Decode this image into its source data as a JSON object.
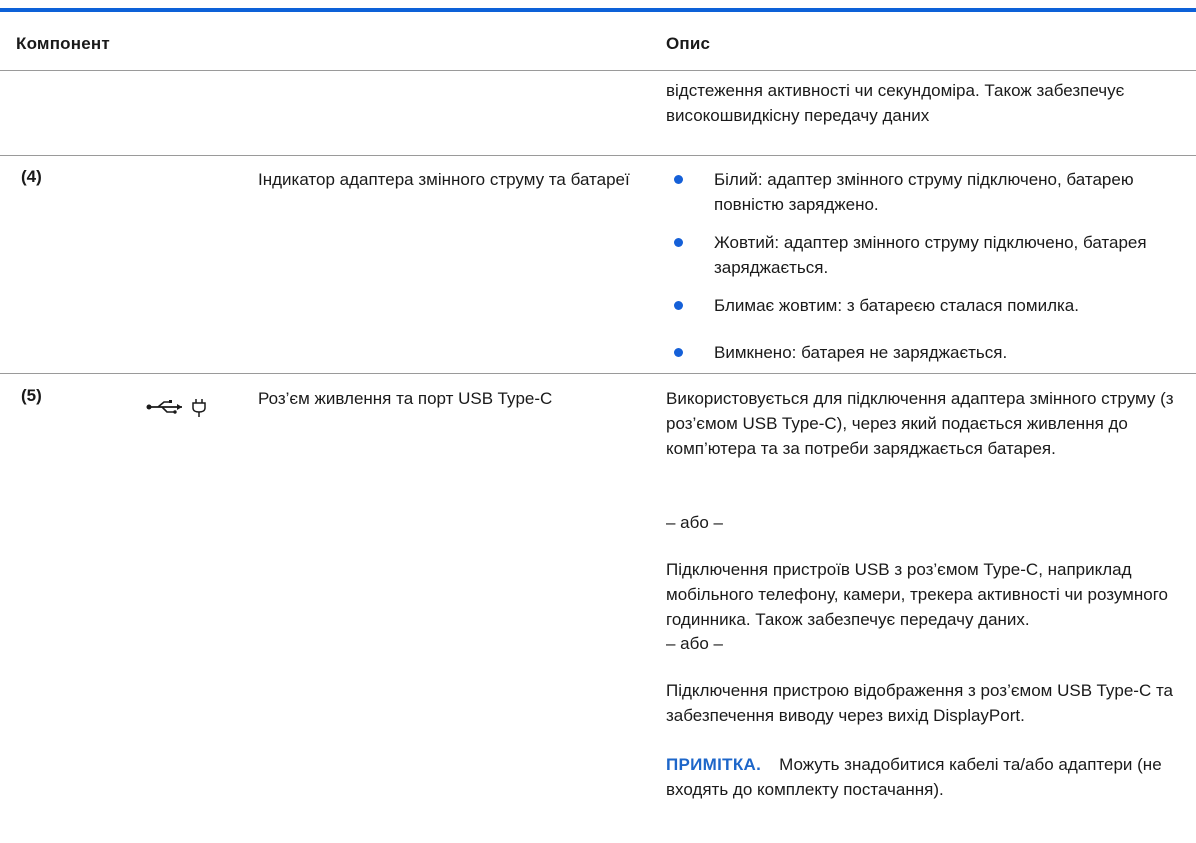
{
  "table": {
    "headers": {
      "component": "Компонент",
      "description": "Опис"
    },
    "continuation": {
      "description": "відстеження активності чи секундоміра. Також забезпечує високошвидкісну передачу даних"
    },
    "row4": {
      "number": "(4)",
      "name": "Індикатор адаптера змінного струму та батареї",
      "bullets": [
        "Білий: адаптер змінного струму підключено, батарею повністю заряджено.",
        "Жовтий: адаптер змінного струму підключено, батарея заряджається.",
        "Блимає жовтим: з батареєю сталася помилка.",
        "Вимкнено: батарея не заряджається."
      ]
    },
    "row5": {
      "number": "(5)",
      "icon": "usb-power-connector-icon",
      "name": "Роз’єм живлення та порт USB Type-C",
      "paragraphs": [
        "Використовується для підключення адаптера змінного струму (з роз’ємом USB Type-C), через який подається живлення до комп’ютера та за потреби заряджається батарея.",
        "– або –",
        "Підключення пристроїв USB з роз’ємом Type-C, наприклад мобільного телефону, камери, трекера активності чи розумного годинника. Також забезпечує передачу даних.",
        "– або –",
        "Підключення пристрою відображення з роз’ємом USB Type-C та забезпечення виводу через вихід DisplayPort."
      ],
      "note_label": "ПРИМІТКА.",
      "note_text": "Можуть знадобитися кабелі та/або адаптери (не входять до комплекту постачання)."
    }
  },
  "colors": {
    "accent_blue": "#0d61d8",
    "note_blue": "#1d66c9",
    "text": "#1a1a1a",
    "divider": "#9a9a9a"
  }
}
